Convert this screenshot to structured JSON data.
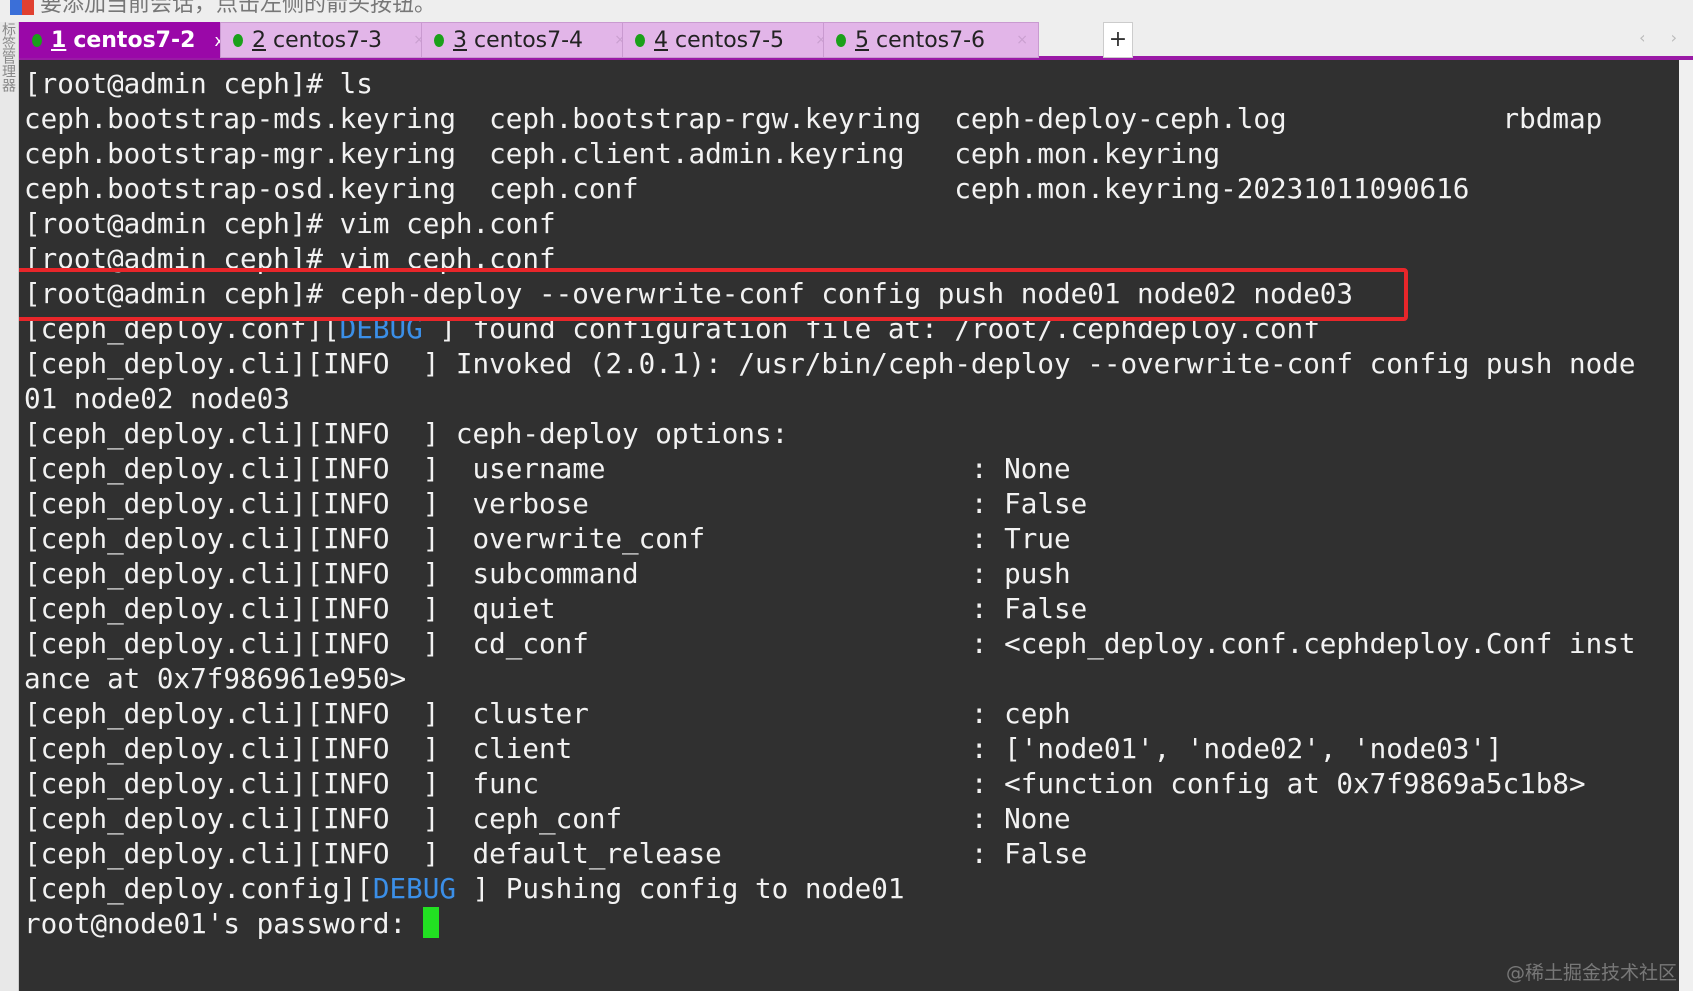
{
  "hint_text": "要添加当前会话，点击左侧的箭头按钮。",
  "left_strip_text": "标签管理器",
  "tabs": [
    {
      "num": "1",
      "label": "centos7-2",
      "active": true
    },
    {
      "num": "2",
      "label": "centos7-3",
      "active": false
    },
    {
      "num": "3",
      "label": "centos7-4",
      "active": false
    },
    {
      "num": "4",
      "label": "centos7-5",
      "active": false
    },
    {
      "num": "5",
      "label": "centos7-6",
      "active": false
    }
  ],
  "add_tab_label": "+",
  "tab_close": "x",
  "colors": {
    "active_tab": "#9a08a8",
    "tab": "#e2b5e8",
    "terminal_bg": "#303030",
    "debug": "#3b8fe8",
    "highlight_box": "#e8262a",
    "cursor": "#22e022",
    "status_dot": "#1aa01a"
  },
  "terminal": {
    "lines": [
      [
        {
          "t": "[root@admin ceph]# ls"
        }
      ],
      [
        {
          "t": "ceph.bootstrap-mds.keyring  ceph.bootstrap-rgw.keyring  ceph-deploy-ceph.log             rbdmap"
        }
      ],
      [
        {
          "t": "ceph.bootstrap-mgr.keyring  ceph.client.admin.keyring   ceph.mon.keyring"
        }
      ],
      [
        {
          "t": "ceph.bootstrap-osd.keyring  ceph.conf                   ceph.mon.keyring-20231011090616"
        }
      ],
      [
        {
          "t": "[root@admin ceph]# vim ceph.conf"
        }
      ],
      [
        {
          "t": "[root@admin ceph]# vim ceph.conf"
        }
      ],
      [
        {
          "t": "[root@admin ceph]# ceph-deploy --overwrite-conf config push node01 node02 node03"
        }
      ],
      [
        {
          "t": "[ceph_deploy.conf][",
          "c": ""
        },
        {
          "t": "DEBUG",
          "c": "dbg"
        },
        {
          "t": " ] found configuration file at: /root/.cephdeploy.conf"
        }
      ],
      [
        {
          "t": "[ceph_deploy.cli][INFO  ] Invoked (2.0.1): /usr/bin/ceph-deploy --overwrite-conf config push node"
        }
      ],
      [
        {
          "t": "01 node02 node03"
        }
      ],
      [
        {
          "t": "[ceph_deploy.cli][INFO  ] ceph-deploy options:"
        }
      ],
      [
        {
          "t": "[ceph_deploy.cli][INFO  ]  username                      : None"
        }
      ],
      [
        {
          "t": "[ceph_deploy.cli][INFO  ]  verbose                       : False"
        }
      ],
      [
        {
          "t": "[ceph_deploy.cli][INFO  ]  overwrite_conf                : True"
        }
      ],
      [
        {
          "t": "[ceph_deploy.cli][INFO  ]  subcommand                    : push"
        }
      ],
      [
        {
          "t": "[ceph_deploy.cli][INFO  ]  quiet                         : False"
        }
      ],
      [
        {
          "t": "[ceph_deploy.cli][INFO  ]  cd_conf                       : <ceph_deploy.conf.cephdeploy.Conf inst"
        }
      ],
      [
        {
          "t": "ance at 0x7f986961e950>"
        }
      ],
      [
        {
          "t": "[ceph_deploy.cli][INFO  ]  cluster                       : ceph"
        }
      ],
      [
        {
          "t": "[ceph_deploy.cli][INFO  ]  client                        : ['node01', 'node02', 'node03']"
        }
      ],
      [
        {
          "t": "[ceph_deploy.cli][INFO  ]  func                          : <function config at 0x7f9869a5c1b8>"
        }
      ],
      [
        {
          "t": "[ceph_deploy.cli][INFO  ]  ceph_conf                     : None"
        }
      ],
      [
        {
          "t": "[ceph_deploy.cli][INFO  ]  default_release               : False"
        }
      ],
      [
        {
          "t": "[ceph_deploy.config]["
        },
        {
          "t": "DEBUG",
          "c": "dbg"
        },
        {
          "t": " ] Pushing config to node01"
        }
      ],
      [
        {
          "t": "root@node01's password: "
        }
      ]
    ],
    "highlighted_line": 6
  },
  "watermark": "@稀土掘金技术社区"
}
